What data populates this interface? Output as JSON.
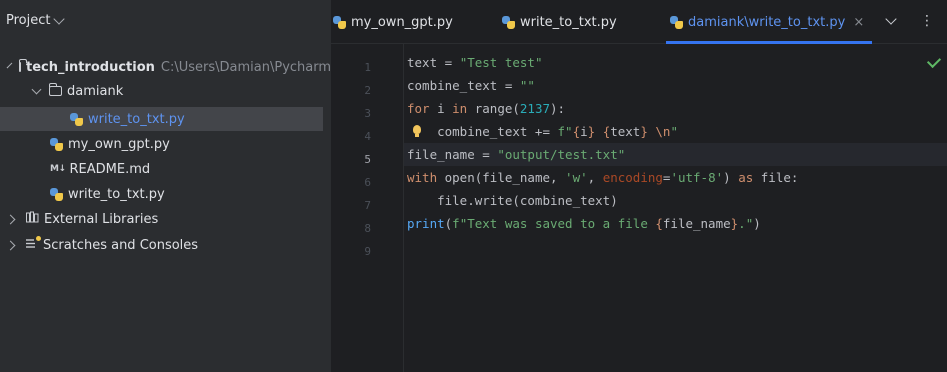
{
  "project_panel": {
    "title": "Project",
    "tree": {
      "root_name": "tech_introduction",
      "root_path": "C:\\Users\\Damian\\Pycharm",
      "folder_name": "damiank",
      "selected_file": "write_to_txt.py",
      "file_1": "my_own_gpt.py",
      "file_2": "README.md",
      "file_3": "write_to_txt.py",
      "external_libraries": "External Libraries",
      "scratches": "Scratches and Consoles",
      "md_icon_text": "M↓"
    }
  },
  "editor": {
    "tabs": [
      {
        "label": "my_own_gpt.py"
      },
      {
        "label": "write_to_txt.py"
      },
      {
        "label": "damiank\\write_to_txt.py"
      }
    ],
    "close_symbol": "×",
    "more_symbol": "⋮",
    "line_numbers": [
      "1",
      "2",
      "3",
      "4",
      "5",
      "6",
      "7",
      "8",
      "9"
    ],
    "current_line": "5",
    "code": {
      "l1": {
        "a": "text = ",
        "b": "\"Test test\""
      },
      "l2": {
        "a": "combine_text = ",
        "b": "\"\""
      },
      "l3": {
        "a": "for",
        "b": " i ",
        "c": "in",
        "d": " range(",
        "e": "2137",
        "f": "):"
      },
      "l4": {
        "a": "    combine_text += ",
        "b": "f\"",
        "c": "{",
        "d": "i",
        "e": "}",
        "f": " ",
        "g": "{",
        "h": "text",
        "i": "}",
        "j": " ",
        "k": "\\n",
        "l": "\""
      },
      "l5": {
        "a": "file_name = ",
        "b": "\"output/test.txt\""
      },
      "l6": {
        "a": "with",
        "b": " open(file_name, ",
        "c": "'w'",
        "d": ", ",
        "e": "encoding",
        "f": "=",
        "g": "'utf-8'",
        "h": ") ",
        "i": "as",
        "j": " file:"
      },
      "l7": {
        "a": "    file.write(combine_text)"
      },
      "l8": {
        "a": "print",
        "b": "(",
        "c": "f\"Text was saved to a file ",
        "d": "{",
        "e": "file_name",
        "f": "}",
        "g": ".\"",
        "h": ")"
      }
    }
  },
  "colors": {
    "background": "#1e1f22",
    "panel": "#2b2d30",
    "keyword": "#cf8e6d",
    "string": "#6aab73",
    "number": "#2aacb8",
    "function": "#56a8f5",
    "accent": "#3574f0"
  },
  "icons": {
    "python_file": "python-file-icon",
    "folder": "folder-icon",
    "markdown": "markdown-icon",
    "library": "library-icon",
    "scratches": "scratches-icon",
    "inspection_ok": "check-icon",
    "intention": "lightbulb-icon"
  }
}
